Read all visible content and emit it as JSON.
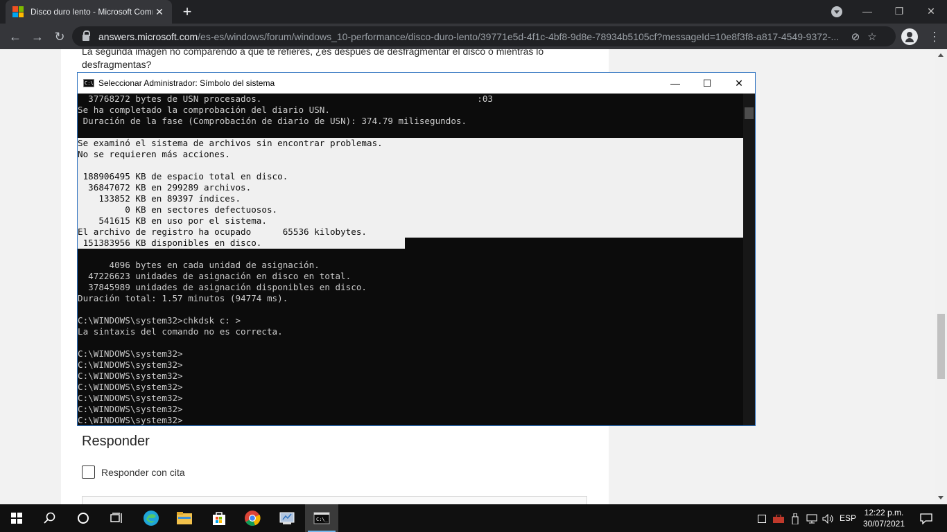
{
  "browser": {
    "tab": {
      "title": "Disco duro lento - Microsoft Community",
      "close": "✕"
    },
    "new_tab": "+",
    "window_controls": {
      "minimize": "—",
      "maximize": "❐",
      "close": "✕"
    },
    "url_domain": "answers.microsoft.com",
    "url_path": "/es-es/windows/forum/windows_10-performance/disco-duro-lento/39771e5d-4f1c-4bf8-9d8e-78934b5105cf?messageId=10e8f3f8-a817-4549-9372-...",
    "icons": {
      "back": "←",
      "forward": "→",
      "reload": "↻",
      "eye_off": "⊘",
      "star": "☆",
      "menu": "⋮"
    }
  },
  "page": {
    "question_text": "La segunda imagen no comparendo a que te refieres, ¿es después de desfragmentar el disco o mientras lo desfragmentas?",
    "reply_heading": "Responder",
    "quote_label": "Responder con cita"
  },
  "cmd": {
    "title": "Seleccionar Administrador: Símbolo del sistema",
    "icon_text": "C:\\",
    "controls": {
      "minimize": "—",
      "maximize": "☐",
      "close": "✕"
    },
    "lines": [
      "  37768272 bytes de USN procesados.                                         :03",
      "Se ha completado la comprobación del diario USN.",
      " Duración de la fase (Comprobación de diario de USN): 374.79 milisegundos.",
      "",
      "Se examinó el sistema de archivos sin encontrar problemas.",
      "No se requieren más acciones.",
      "",
      " 188906495 KB de espacio total en disco.",
      "  36847072 KB en 299289 archivos.",
      "    133852 KB en 89397 índices.",
      "         0 KB en sectores defectuosos.",
      "    541615 KB en uso por el sistema.",
      "El archivo de registro ha ocupado      65536 kilobytes.",
      " 151383956 KB disponibles en disco.",
      "",
      "      4096 bytes en cada unidad de asignación.",
      "  47226623 unidades de asignación en disco en total.",
      "  37845989 unidades de asignación disponibles en disco.",
      "Duración total: 1.57 minutos (94774 ms).",
      "",
      "C:\\WINDOWS\\system32>chkdsk c: >",
      "La sintaxis del comando no es correcta.",
      "",
      "C:\\WINDOWS\\system32>",
      "C:\\WINDOWS\\system32>",
      "C:\\WINDOWS\\system32>",
      "C:\\WINDOWS\\system32>",
      "C:\\WINDOWS\\system32>",
      "C:\\WINDOWS\\system32>",
      "C:\\WINDOWS\\system32>"
    ],
    "highlighted_lines": [
      4,
      5,
      6,
      7,
      8,
      9,
      10,
      11,
      12,
      13
    ]
  },
  "taskbar": {
    "apps": [
      "start",
      "search",
      "cortana",
      "task-view",
      "edge",
      "file-explorer",
      "store",
      "chrome",
      "control-panel",
      "command-prompt"
    ],
    "tray": {
      "language": "ESP"
    },
    "clock": {
      "time": "12:22 p.m.",
      "date": "30/07/2021"
    },
    "colors": {
      "accent": "#76b9ed",
      "win_blue": "#ffffff"
    }
  },
  "colors": {
    "ms_red": "#f25022",
    "ms_green": "#7fba00",
    "ms_blue": "#00a4ef",
    "ms_yellow": "#ffb900",
    "console_fg": "#cccccc",
    "console_bg": "#0c0c0c",
    "selection": "#f0f0f0"
  }
}
